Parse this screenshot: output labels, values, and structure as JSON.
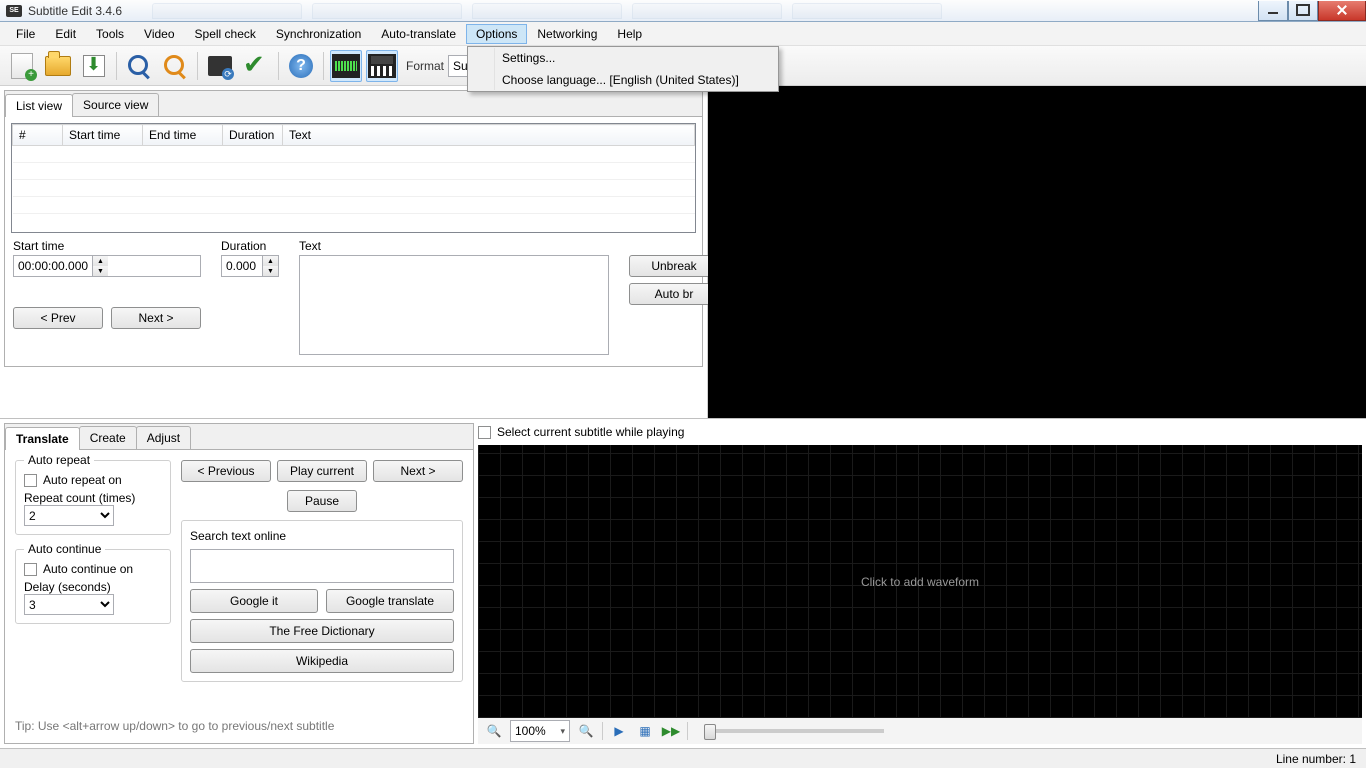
{
  "window": {
    "title": "Subtitle Edit 3.4.6"
  },
  "menubar": {
    "file": "File",
    "edit": "Edit",
    "tools": "Tools",
    "video": "Video",
    "spellcheck": "Spell check",
    "sync": "Synchronization",
    "autotrans": "Auto-translate",
    "options": "Options",
    "networking": "Networking",
    "help": "Help"
  },
  "options_menu": {
    "settings": "Settings...",
    "choose_lang": "Choose language... [English (United States)]"
  },
  "toolbar": {
    "format_label": "Format",
    "subformat_prefix": "Sub"
  },
  "listview": {
    "tab_list": "List view",
    "tab_source": "Source view",
    "cols": {
      "num": "#",
      "start": "Start time",
      "end": "End time",
      "dur": "Duration",
      "text": "Text"
    }
  },
  "edit": {
    "start_label": "Start time",
    "start_value": "00:00:00.000",
    "dur_label": "Duration",
    "dur_value": "0.000",
    "text_label": "Text",
    "unbreak": "Unbreak",
    "autobr": "Auto br",
    "prev": "< Prev",
    "next": "Next >"
  },
  "translate": {
    "tab_translate": "Translate",
    "tab_create": "Create",
    "tab_adjust": "Adjust",
    "auto_repeat": "Auto repeat",
    "auto_repeat_on": "Auto repeat on",
    "repeat_count": "Repeat count (times)",
    "repeat_val": "2",
    "auto_continue": "Auto continue",
    "auto_continue_on": "Auto continue on",
    "delay": "Delay (seconds)",
    "delay_val": "3",
    "previous": "< Previous",
    "play_current": "Play current",
    "next": "Next >",
    "pause": "Pause",
    "search_label": "Search text online",
    "google_it": "Google it",
    "google_translate": "Google translate",
    "free_dict": "The Free Dictionary",
    "wikipedia": "Wikipedia",
    "tip": "Tip: Use <alt+arrow up/down> to go to previous/next subtitle"
  },
  "waveform": {
    "select_current": "Select current subtitle while playing",
    "placeholder": "Click to add waveform",
    "zoom_label": "100%"
  },
  "status": {
    "line": "Line number: 1"
  }
}
